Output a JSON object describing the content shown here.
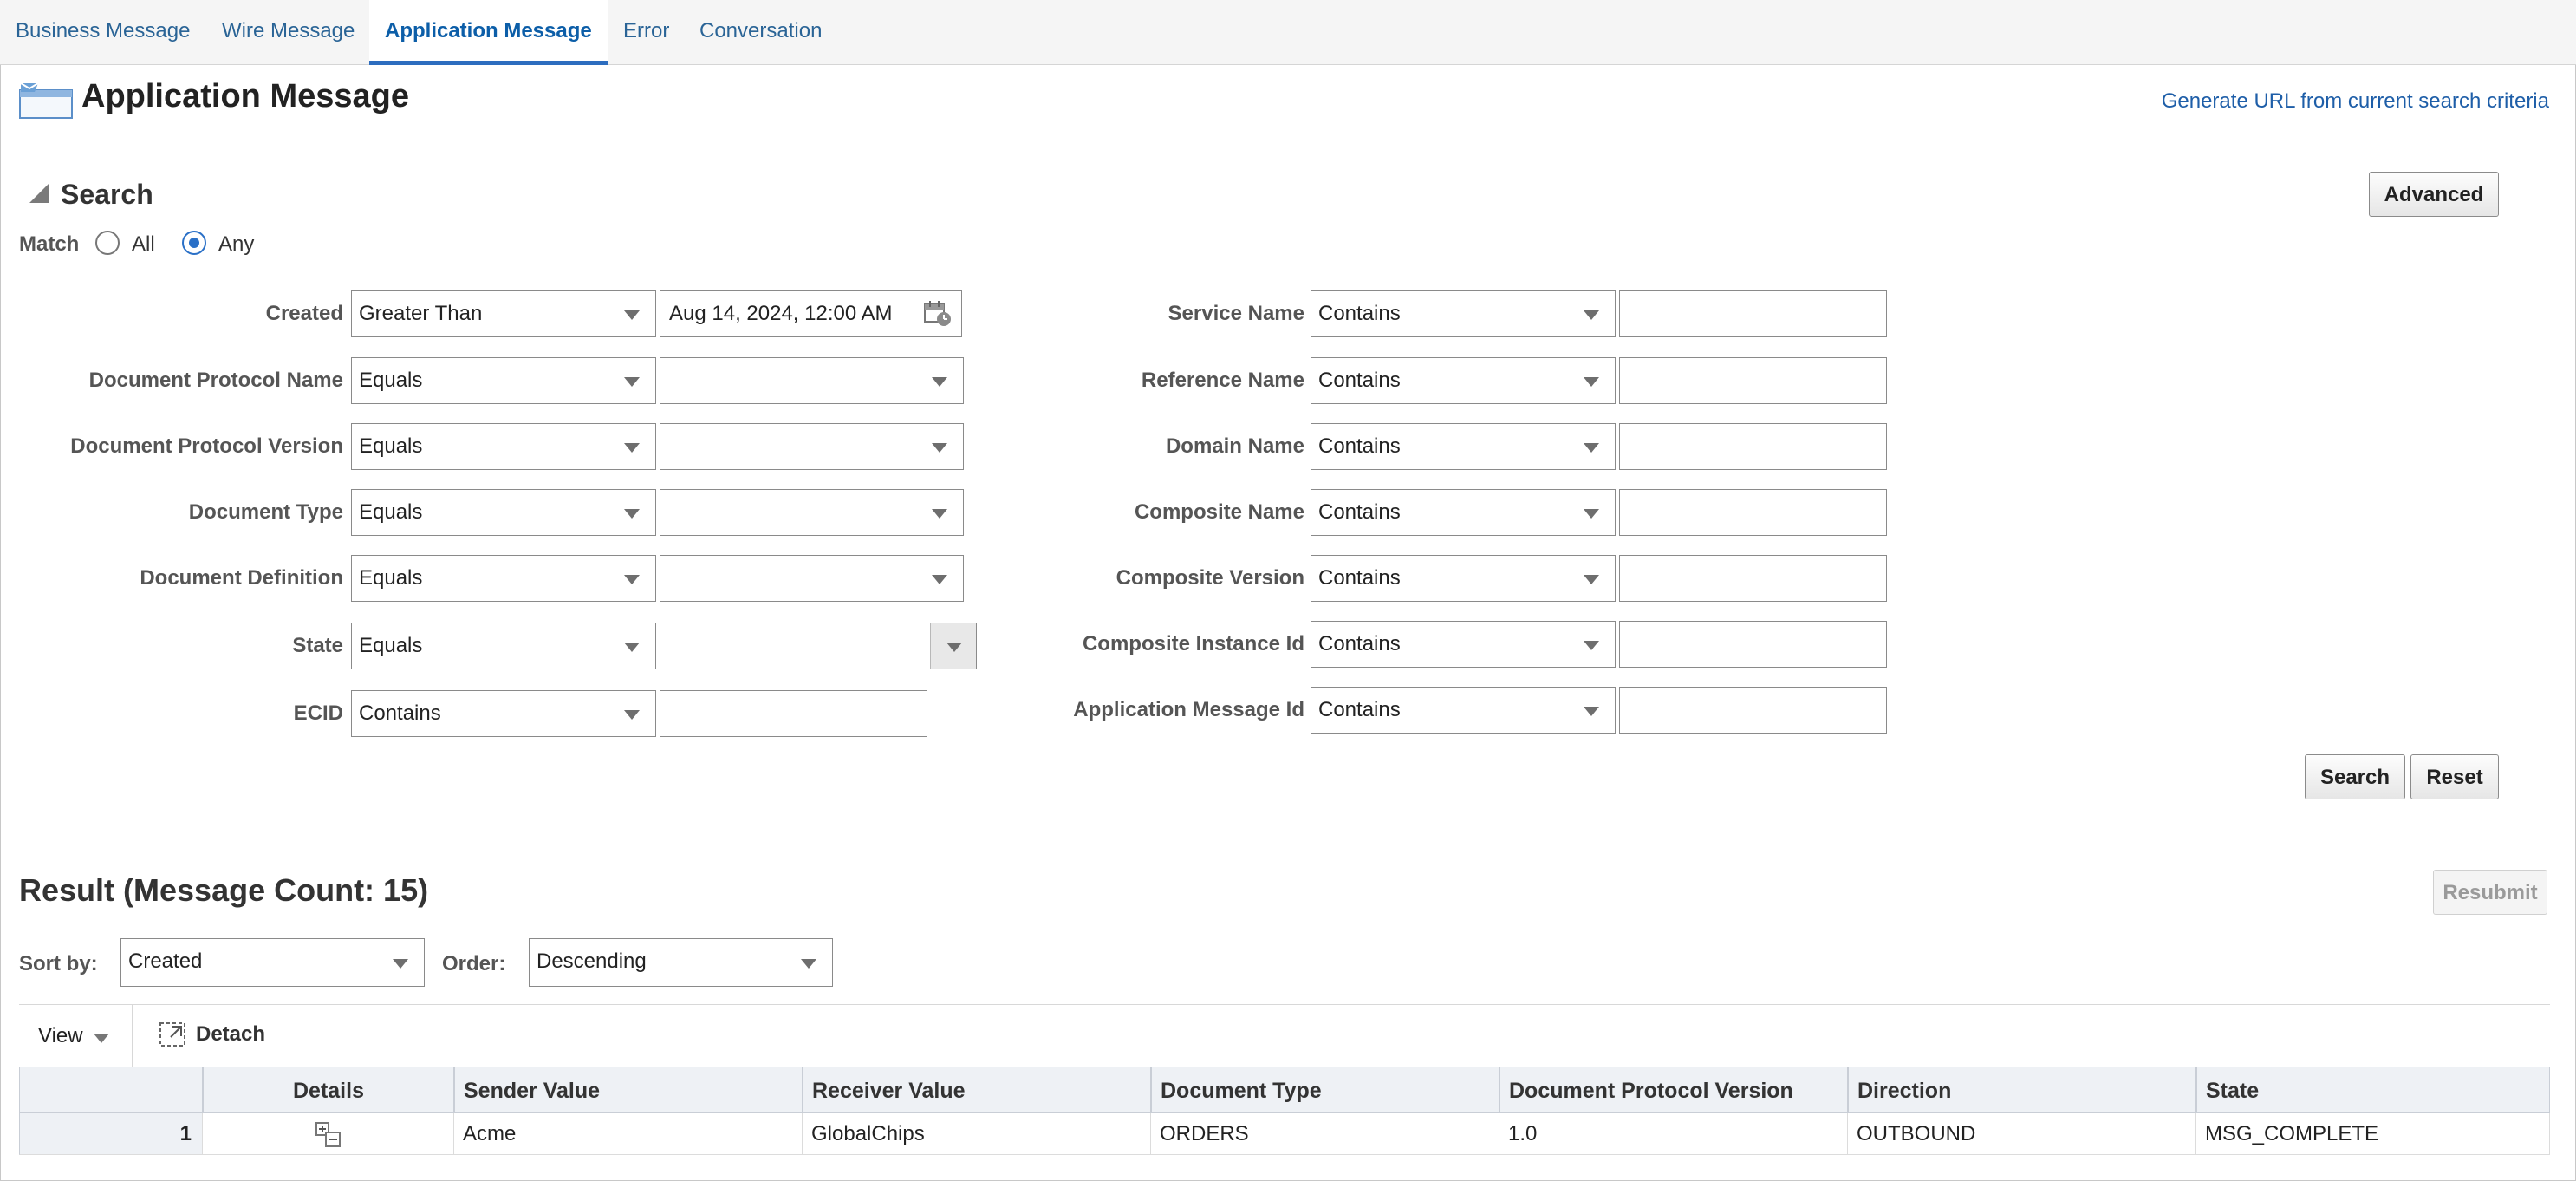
{
  "tabs": [
    "Business Message",
    "Wire Message",
    "Application Message",
    "Error",
    "Conversation"
  ],
  "active_tab": "Application Message",
  "page": {
    "title": "Application Message",
    "icon": "message-window-icon",
    "generate_url_link": "Generate URL from current search criteria"
  },
  "search": {
    "title": "Search",
    "advanced_label": "Advanced",
    "match_label": "Match",
    "match_all": "All",
    "match_any": "Any",
    "match_selected": "Any",
    "left_fields": [
      {
        "label": "Created",
        "operator": "Greater Than",
        "value": "Aug 14, 2024, 12:00 AM",
        "value_type": "date"
      },
      {
        "label": "Document Protocol Name",
        "operator": "Equals",
        "value": "",
        "value_type": "select"
      },
      {
        "label": "Document Protocol Version",
        "operator": "Equals",
        "value": "",
        "value_type": "select"
      },
      {
        "label": "Document Type",
        "operator": "Equals",
        "value": "",
        "value_type": "select"
      },
      {
        "label": "Document Definition",
        "operator": "Equals",
        "value": "",
        "value_type": "select"
      },
      {
        "label": "State",
        "operator": "Equals",
        "value": "",
        "value_type": "select-button"
      },
      {
        "label": "ECID",
        "operator": "Contains",
        "value": "",
        "value_type": "text"
      }
    ],
    "right_fields": [
      {
        "label": "Service Name",
        "operator": "Contains",
        "value": ""
      },
      {
        "label": "Reference Name",
        "operator": "Contains",
        "value": ""
      },
      {
        "label": "Domain Name",
        "operator": "Contains",
        "value": ""
      },
      {
        "label": "Composite Name",
        "operator": "Contains",
        "value": ""
      },
      {
        "label": "Composite Version",
        "operator": "Contains",
        "value": ""
      },
      {
        "label": "Composite Instance Id",
        "operator": "Contains",
        "value": ""
      },
      {
        "label": "Application Message Id",
        "operator": "Contains",
        "value": ""
      }
    ],
    "search_button": "Search",
    "reset_button": "Reset"
  },
  "result": {
    "title": "Result (Message Count: 15)",
    "resubmit_label": "Resubmit",
    "sort_by_label": "Sort by:",
    "sort_by_value": "Created",
    "order_label": "Order:",
    "order_value": "Descending",
    "view_label": "View",
    "detach_label": "Detach",
    "columns": [
      "",
      "Details",
      "Sender Value",
      "Receiver Value",
      "Document Type",
      "Document Protocol Version",
      "Direction",
      "State"
    ],
    "rows": [
      {
        "num": "1",
        "sender": "Acme",
        "receiver": "GlobalChips",
        "doc_type": "ORDERS",
        "protocol_version": "1.0",
        "direction": "OUTBOUND",
        "state": "MSG_COMPLETE"
      }
    ]
  },
  "colors": {
    "link": "#1e5ea8",
    "active_tab_underline": "#2d6dbf",
    "header_bg": "#eef1f5"
  }
}
